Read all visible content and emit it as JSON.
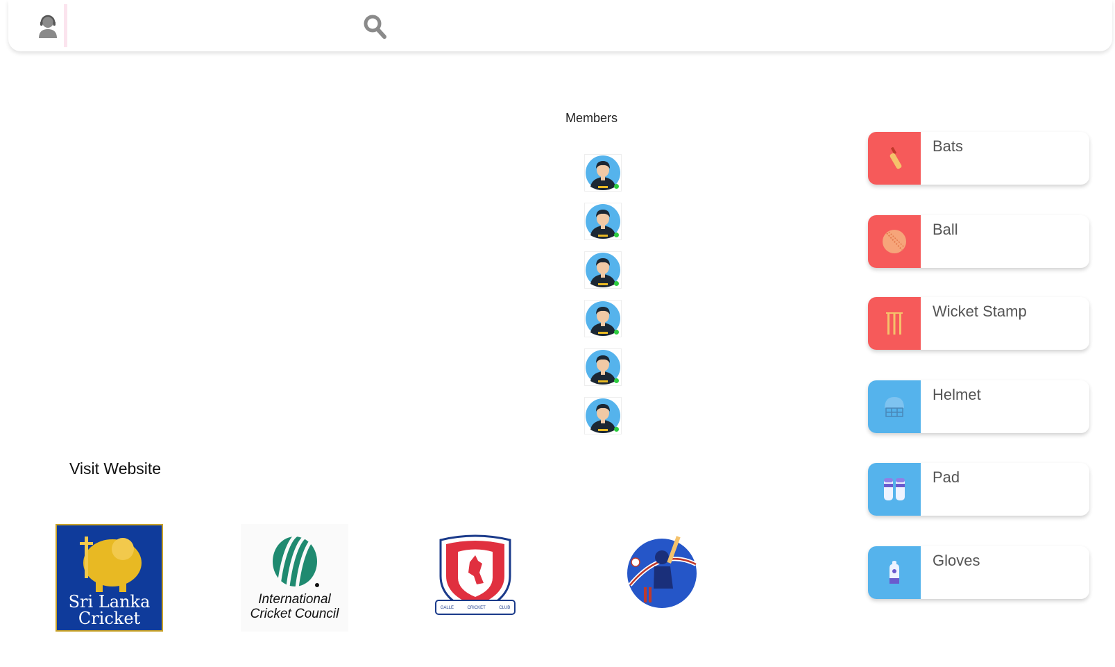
{
  "header": {
    "support_icon": "customer-support-icon",
    "search_icon": "search-icon"
  },
  "members": {
    "title": "Members",
    "items": [
      {
        "avatar": "user-avatar",
        "status": "online"
      },
      {
        "avatar": "user-avatar",
        "status": "online"
      },
      {
        "avatar": "user-avatar",
        "status": "online"
      },
      {
        "avatar": "user-avatar",
        "status": "online"
      },
      {
        "avatar": "user-avatar",
        "status": "online"
      },
      {
        "avatar": "user-avatar",
        "status": "online"
      }
    ]
  },
  "websites": {
    "title": "Visit Website",
    "logos": [
      {
        "name": "sri-lanka-cricket",
        "line1": "Sri Lanka",
        "line2": "Cricket"
      },
      {
        "name": "icc",
        "line1": "International",
        "line2": "Cricket Council"
      },
      {
        "name": "galle-cricket-club",
        "band": [
          "GALLE",
          "CRICKET",
          "CLUB"
        ]
      },
      {
        "name": "cricket-batsman-logo"
      }
    ]
  },
  "equipment": [
    {
      "label": "Bats",
      "icon": "bat-icon",
      "color": "#f65a5a"
    },
    {
      "label": "Ball",
      "icon": "ball-icon",
      "color": "#f65a5a"
    },
    {
      "label": "Wicket Stamp",
      "icon": "wicket-icon",
      "color": "#f65a5a"
    },
    {
      "label": "Helmet",
      "icon": "helmet-icon",
      "color": "#55b3ec"
    },
    {
      "label": "Pad",
      "icon": "pad-icon",
      "color": "#55b3ec"
    },
    {
      "label": "Gloves",
      "icon": "gloves-icon",
      "color": "#55b3ec"
    }
  ],
  "colors": {
    "accent_red": "#f65a5a",
    "accent_blue": "#55b3ec",
    "online": "#2ecc40"
  }
}
